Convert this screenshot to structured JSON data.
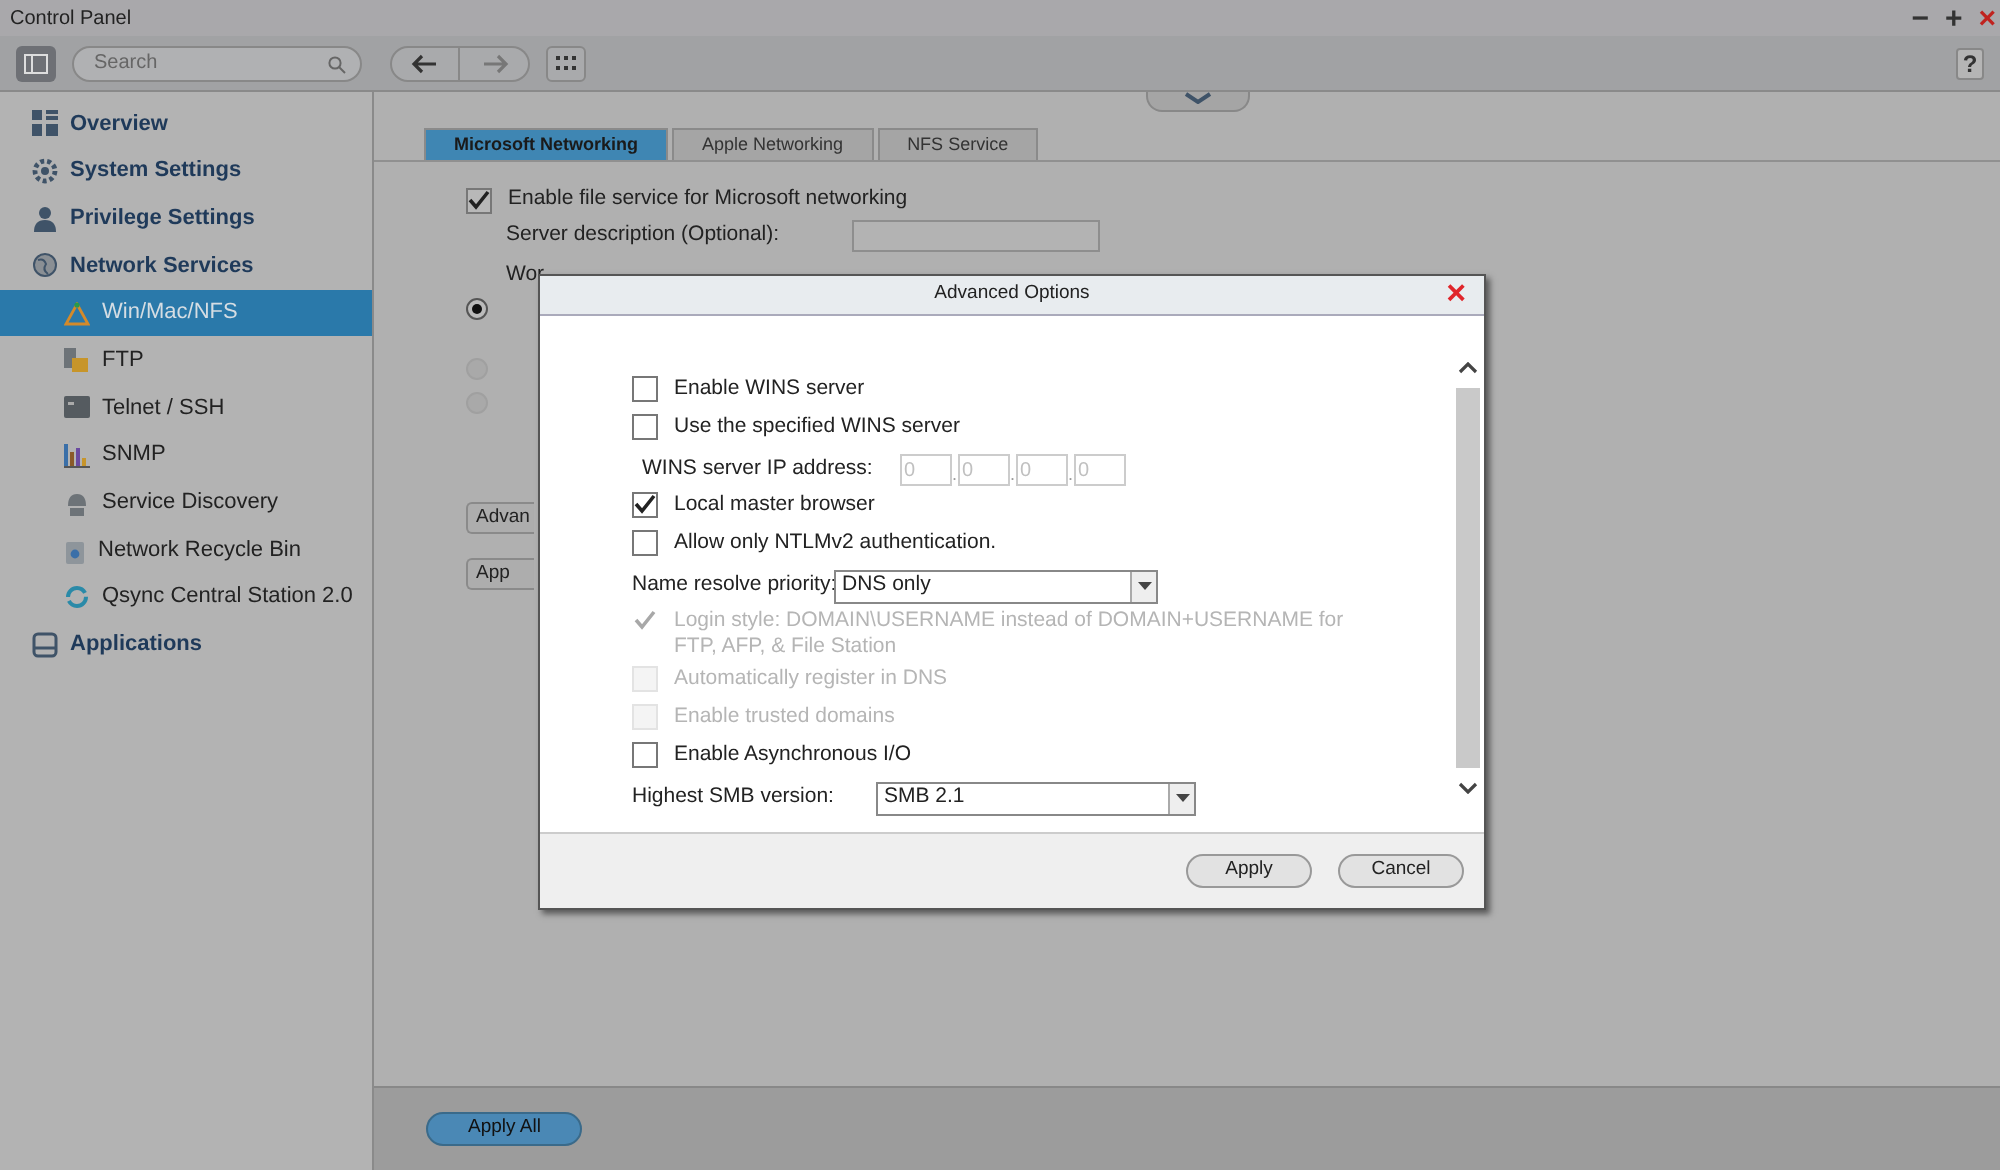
{
  "window": {
    "title": "Control Panel",
    "controls": [
      "−",
      "+",
      "×"
    ]
  },
  "toolbar": {
    "search_placeholder": "Search",
    "help": "?"
  },
  "sidebar": [
    {
      "label": "Overview",
      "selected": false
    },
    {
      "label": "System Settings",
      "selected": false
    },
    {
      "label": "Privilege Settings",
      "selected": false
    },
    {
      "label": "Network Services",
      "selected": false,
      "children": [
        {
          "label": "Win/Mac/NFS",
          "selected": true
        },
        {
          "label": "FTP",
          "selected": false
        },
        {
          "label": "Telnet / SSH",
          "selected": false
        },
        {
          "label": "SNMP",
          "selected": false
        },
        {
          "label": "Service Discovery",
          "selected": false
        },
        {
          "label": "Network Recycle Bin",
          "selected": false
        },
        {
          "label": "Qsync Central Station 2.0",
          "selected": false
        }
      ]
    },
    {
      "label": "Applications",
      "selected": false
    }
  ],
  "tabs": [
    {
      "label": "Microsoft Networking",
      "selected": true
    },
    {
      "label": "Apple Networking",
      "selected": false
    },
    {
      "label": "NFS Service",
      "selected": false
    }
  ],
  "form": {
    "enable": {
      "label": "Enable file service for Microsoft networking",
      "checked": true
    },
    "server_description": "Server description (Optional):",
    "workgroup": "Wor",
    "radios": [
      {
        "selected": true
      },
      {
        "selected": false
      },
      {
        "selected": false
      }
    ],
    "buttons": [
      "Advan",
      "App"
    ]
  },
  "dialog": {
    "title": "Advanced Options",
    "close": "×",
    "options": [
      {
        "kind": "checkbox",
        "label": "Enable WINS server",
        "checked": false,
        "disabled": false
      },
      {
        "kind": "checkbox",
        "label": "Use the specified WINS server",
        "checked": false,
        "disabled": false
      },
      {
        "kind": "ip",
        "label": "WINS server IP address:",
        "octets": [
          "0",
          "0",
          "0",
          "0"
        ],
        "separators": [
          ".",
          ".",
          "."
        ]
      },
      {
        "kind": "checkbox",
        "label": "Local master browser",
        "checked": true,
        "disabled": false
      },
      {
        "kind": "checkbox",
        "label": "Allow only NTLMv2 authentication.",
        "checked": false,
        "disabled": false
      },
      {
        "kind": "select",
        "label": "Name resolve priority:",
        "value": "DNS only"
      },
      {
        "kind": "checkbox",
        "label": "Login style: DOMAIN\\USERNAME instead of DOMAIN+USERNAME for FTP, AFP, & File Station",
        "checked": true,
        "disabled": true
      },
      {
        "kind": "checkbox",
        "label": "Automatically register in DNS",
        "checked": false,
        "disabled": true
      },
      {
        "kind": "checkbox",
        "label": "Enable trusted domains",
        "checked": false,
        "disabled": true
      },
      {
        "kind": "checkbox",
        "label": "Enable Asynchronous I/O",
        "checked": false,
        "disabled": false
      },
      {
        "kind": "select",
        "label": "Highest SMB version:",
        "value": "SMB 2.1"
      }
    ],
    "buttons": [
      "Apply",
      "Cancel"
    ]
  },
  "apply_all": "Apply All"
}
